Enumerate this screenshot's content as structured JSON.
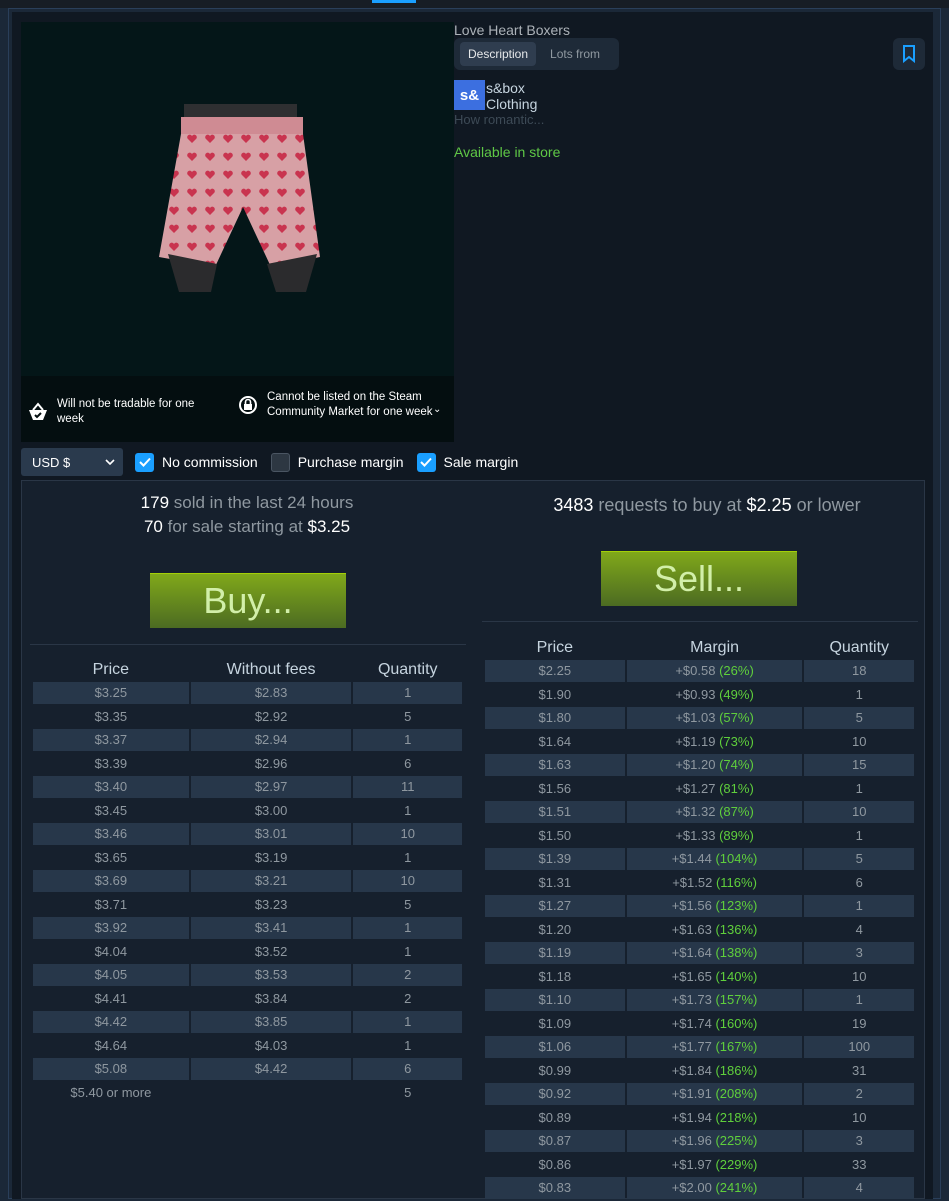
{
  "item": {
    "title": "Love Heart Boxers",
    "tabs": [
      "Description",
      "Lots from"
    ],
    "app_logo": "s&",
    "app_name": "s&box",
    "category": "Clothing",
    "description": "How romantic...",
    "availability": "Available in store",
    "notices": [
      "Will not be tradable for one week",
      "Cannot be listed on the Steam Community Market for one week"
    ]
  },
  "controls": {
    "currency": "USD $",
    "checkboxes": [
      {
        "label": "No commission",
        "checked": true
      },
      {
        "label": "Purchase margin",
        "checked": false
      },
      {
        "label": "Sale margin",
        "checked": true
      }
    ]
  },
  "sell_side": {
    "sold_count": "179",
    "sold_text": "sold in the last 24 hours",
    "for_sale_count": "70",
    "for_sale_text": "for sale starting at",
    "start_price": "$3.25",
    "buy_label": "Buy...",
    "headers": [
      "Price",
      "Without fees",
      "Quantity"
    ],
    "rows": [
      [
        "$3.25",
        "$2.83",
        "1"
      ],
      [
        "$3.35",
        "$2.92",
        "5"
      ],
      [
        "$3.37",
        "$2.94",
        "1"
      ],
      [
        "$3.39",
        "$2.96",
        "6"
      ],
      [
        "$3.40",
        "$2.97",
        "11"
      ],
      [
        "$3.45",
        "$3.00",
        "1"
      ],
      [
        "$3.46",
        "$3.01",
        "10"
      ],
      [
        "$3.65",
        "$3.19",
        "1"
      ],
      [
        "$3.69",
        "$3.21",
        "10"
      ],
      [
        "$3.71",
        "$3.23",
        "5"
      ],
      [
        "$3.92",
        "$3.41",
        "1"
      ],
      [
        "$4.04",
        "$3.52",
        "1"
      ],
      [
        "$4.05",
        "$3.53",
        "2"
      ],
      [
        "$4.41",
        "$3.84",
        "2"
      ],
      [
        "$4.42",
        "$3.85",
        "1"
      ],
      [
        "$4.64",
        "$4.03",
        "1"
      ],
      [
        "$5.08",
        "$4.42",
        "6"
      ]
    ],
    "footer": [
      "$5.40 or more",
      "5"
    ]
  },
  "buy_side": {
    "requests_count": "3483",
    "requests_text": "requests to buy at",
    "price": "$2.25",
    "suffix": "or lower",
    "sell_label": "Sell...",
    "headers": [
      "Price",
      "Margin",
      "Quantity"
    ],
    "rows": [
      [
        "$2.25",
        "+$0.58",
        "(26%)",
        "18"
      ],
      [
        "$1.90",
        "+$0.93",
        "(49%)",
        "1"
      ],
      [
        "$1.80",
        "+$1.03",
        "(57%)",
        "5"
      ],
      [
        "$1.64",
        "+$1.19",
        "(73%)",
        "10"
      ],
      [
        "$1.63",
        "+$1.20",
        "(74%)",
        "15"
      ],
      [
        "$1.56",
        "+$1.27",
        "(81%)",
        "1"
      ],
      [
        "$1.51",
        "+$1.32",
        "(87%)",
        "10"
      ],
      [
        "$1.50",
        "+$1.33",
        "(89%)",
        "1"
      ],
      [
        "$1.39",
        "+$1.44",
        "(104%)",
        "5"
      ],
      [
        "$1.31",
        "+$1.52",
        "(116%)",
        "6"
      ],
      [
        "$1.27",
        "+$1.56",
        "(123%)",
        "1"
      ],
      [
        "$1.20",
        "+$1.63",
        "(136%)",
        "4"
      ],
      [
        "$1.19",
        "+$1.64",
        "(138%)",
        "3"
      ],
      [
        "$1.18",
        "+$1.65",
        "(140%)",
        "10"
      ],
      [
        "$1.10",
        "+$1.73",
        "(157%)",
        "1"
      ],
      [
        "$1.09",
        "+$1.74",
        "(160%)",
        "19"
      ],
      [
        "$1.06",
        "+$1.77",
        "(167%)",
        "100"
      ],
      [
        "$0.99",
        "+$1.84",
        "(186%)",
        "31"
      ],
      [
        "$0.92",
        "+$1.91",
        "(208%)",
        "2"
      ],
      [
        "$0.89",
        "+$1.94",
        "(218%)",
        "10"
      ],
      [
        "$0.87",
        "+$1.96",
        "(225%)",
        "3"
      ],
      [
        "$0.86",
        "+$1.97",
        "(229%)",
        "33"
      ],
      [
        "$0.83",
        "+$2.00",
        "(241%)",
        "4"
      ]
    ]
  },
  "colors": {
    "accent": "#1a9fff",
    "positive": "#5fcf3c",
    "available": "#5fc846",
    "button_green": "#80a81a"
  }
}
